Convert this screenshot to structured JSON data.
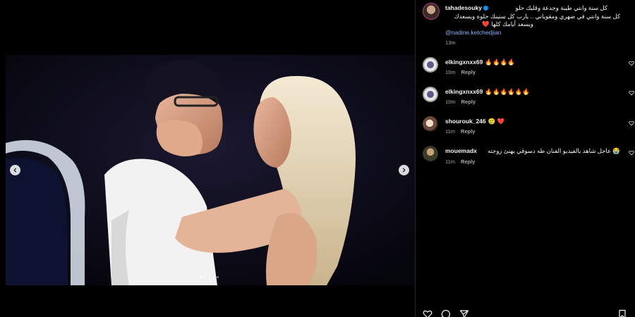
{
  "post": {
    "media": {
      "prev_icon": "chevron-left-icon",
      "next_icon": "chevron-right-icon",
      "carousel_count": 5,
      "carousel_active_index": 0
    },
    "caption": {
      "username": "tahadesouky",
      "line1": "كل سنة وانتي طيبة وجدعة وقلبك حلو",
      "line2": "كل سنة وانتي في ضهري ومقوياني .. يارب كل سنينك حلوة ويسعدك",
      "line3": "ويسعد أيامك كلها",
      "heart": "❤️",
      "mention": "@nadine.ketchedjian",
      "time": "13m"
    },
    "comments": [
      {
        "username": "elkingxnxx69",
        "text": "🔥🔥🔥🔥",
        "time": "10m",
        "reply": "Reply"
      },
      {
        "username": "elkingxnxx69",
        "text": "🔥🔥🔥🔥🔥🔥",
        "time": "10m",
        "reply": "Reply"
      },
      {
        "username": "shourouk_246",
        "text": "🥲 ❤️",
        "time": "11m",
        "reply": "Reply"
      },
      {
        "username": "mouemadx",
        "text": "😭 عاجل شاهد بالفيديو الفنان طه دسوقي يهنئ زوجته",
        "time": "11m",
        "reply": "Reply"
      }
    ]
  },
  "colors": {
    "background": "#000000",
    "text": "#f5f5f5",
    "muted": "#a8a8a8",
    "link": "#8ab4f8",
    "verified": "#0095f6"
  }
}
